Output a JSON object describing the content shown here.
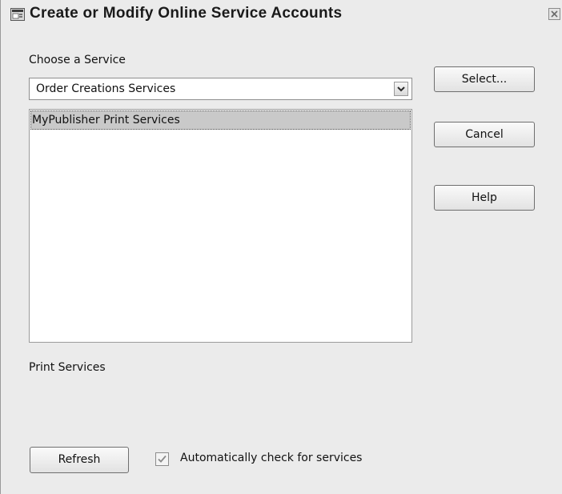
{
  "dialog": {
    "title": "Create or Modify Online Service Accounts",
    "title_icon": "computer-window-icon",
    "close_icon": "close-icon"
  },
  "service_chooser": {
    "label": "Choose a Service",
    "selected": "Order Creations Services",
    "dropdown_icon": "chevron-down-icon"
  },
  "service_list": {
    "items": [
      {
        "label": "MyPublisher Print Services",
        "selected": true
      }
    ]
  },
  "buttons": {
    "select": "Select...",
    "cancel": "Cancel",
    "help": "Help",
    "refresh": "Refresh"
  },
  "category_label": "Print Services",
  "auto_check": {
    "label": "Automatically check for services",
    "checked": true
  }
}
